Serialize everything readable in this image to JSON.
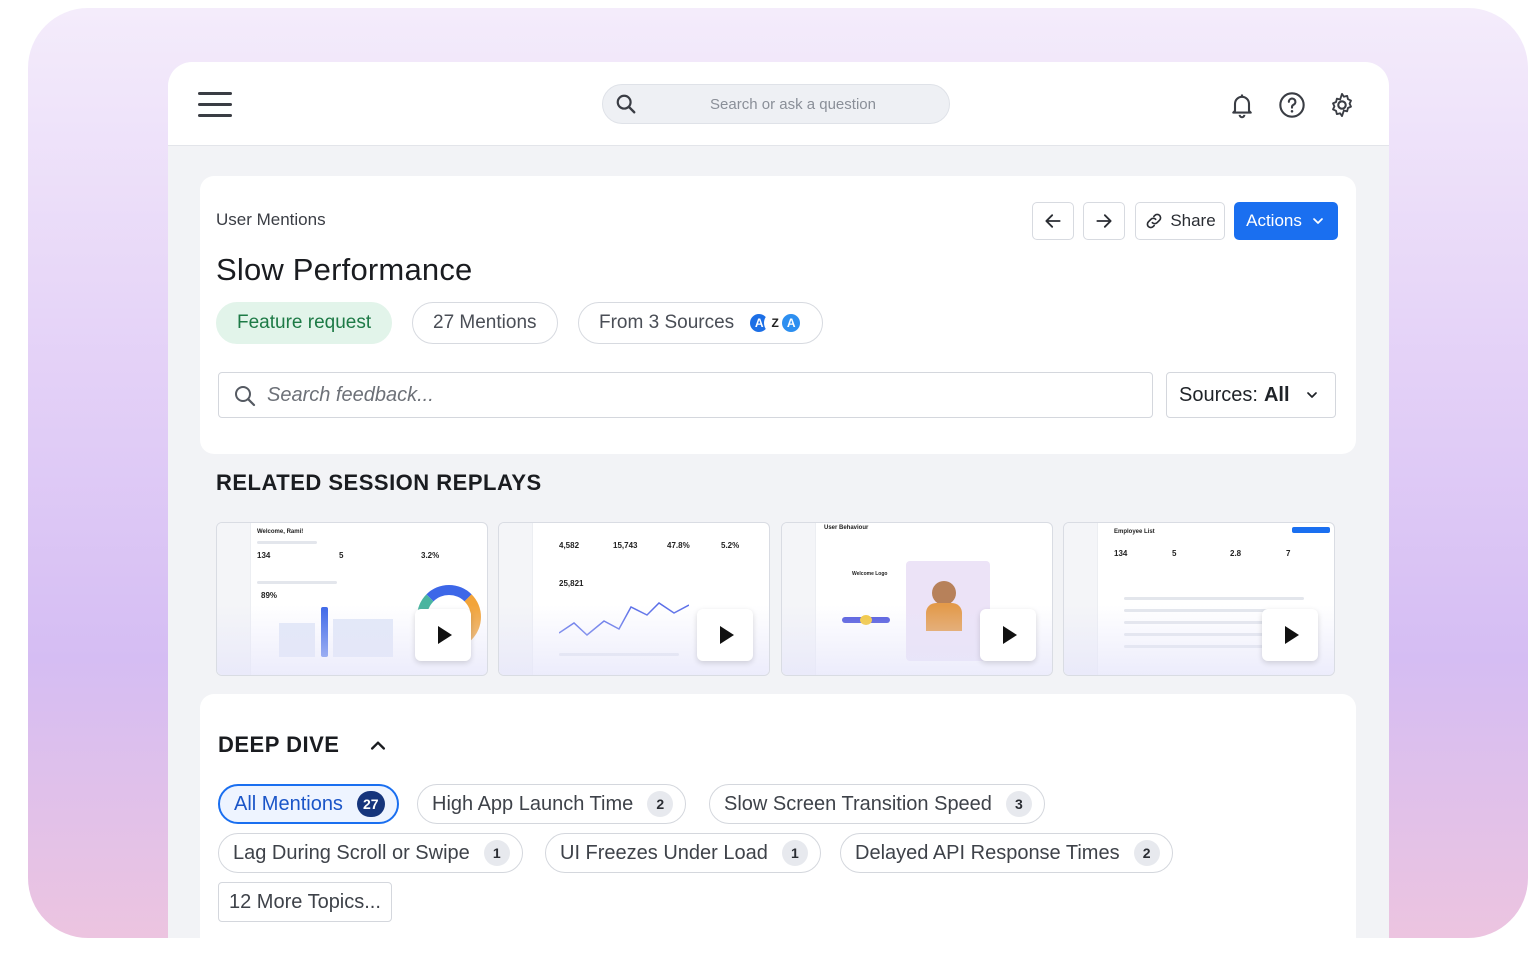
{
  "topbar": {
    "search_placeholder": "Search or ask a question",
    "icons": [
      "menu-icon",
      "search-icon",
      "bell-icon",
      "help-icon",
      "gear-icon"
    ]
  },
  "header": {
    "breadcrumb": "User Mentions",
    "title": "Slow Performance",
    "share_label": "Share",
    "actions_label": "Actions"
  },
  "pills": {
    "category": "Feature request",
    "mentions": "27 Mentions",
    "sources": "From 3 Sources",
    "source_icons": [
      {
        "glyph": "A",
        "color": "#1c6fe6"
      },
      {
        "glyph": "Z",
        "color": "#222222"
      },
      {
        "glyph": "A",
        "color": "#2d8ff0"
      }
    ]
  },
  "feedback": {
    "search_placeholder": "Search feedback...",
    "sources_label": "Sources:",
    "sources_value": "All"
  },
  "replays": {
    "title": "RELATED SESSION REPLAYS",
    "items": [
      {
        "heading": "Welcome, Rami!",
        "stats": [
          "134",
          "5",
          "3.2%"
        ],
        "extra": "89%"
      },
      {
        "heading": "",
        "stats": [
          "4,582",
          "15,743",
          "47.8%",
          "5.2%"
        ],
        "extra": "25,821"
      },
      {
        "heading": "User Behaviour",
        "stats": [],
        "extra": "Welcome Logo"
      },
      {
        "heading": "Employee List",
        "stats": [
          "134",
          "5",
          "2.8",
          "7"
        ],
        "extra": ""
      }
    ]
  },
  "deep_dive": {
    "title": "DEEP DIVE",
    "topics": [
      {
        "label": "All Mentions",
        "count": "27"
      },
      {
        "label": "High App Launch Time",
        "count": "2"
      },
      {
        "label": "Slow Screen Transition Speed",
        "count": "3"
      },
      {
        "label": "Lag During Scroll or Swipe",
        "count": "1"
      },
      {
        "label": "UI Freezes Under Load",
        "count": "1"
      },
      {
        "label": "Delayed API Response Times",
        "count": "2"
      }
    ],
    "more_label": "12 More Topics..."
  },
  "colors": {
    "accent": "#1a6ff0",
    "feature_bg": "#e2f4ea",
    "feature_text": "#1d7a46",
    "frame_gradient_top": "#f4ecfb",
    "frame_gradient_bottom": "#ecc4e0"
  }
}
